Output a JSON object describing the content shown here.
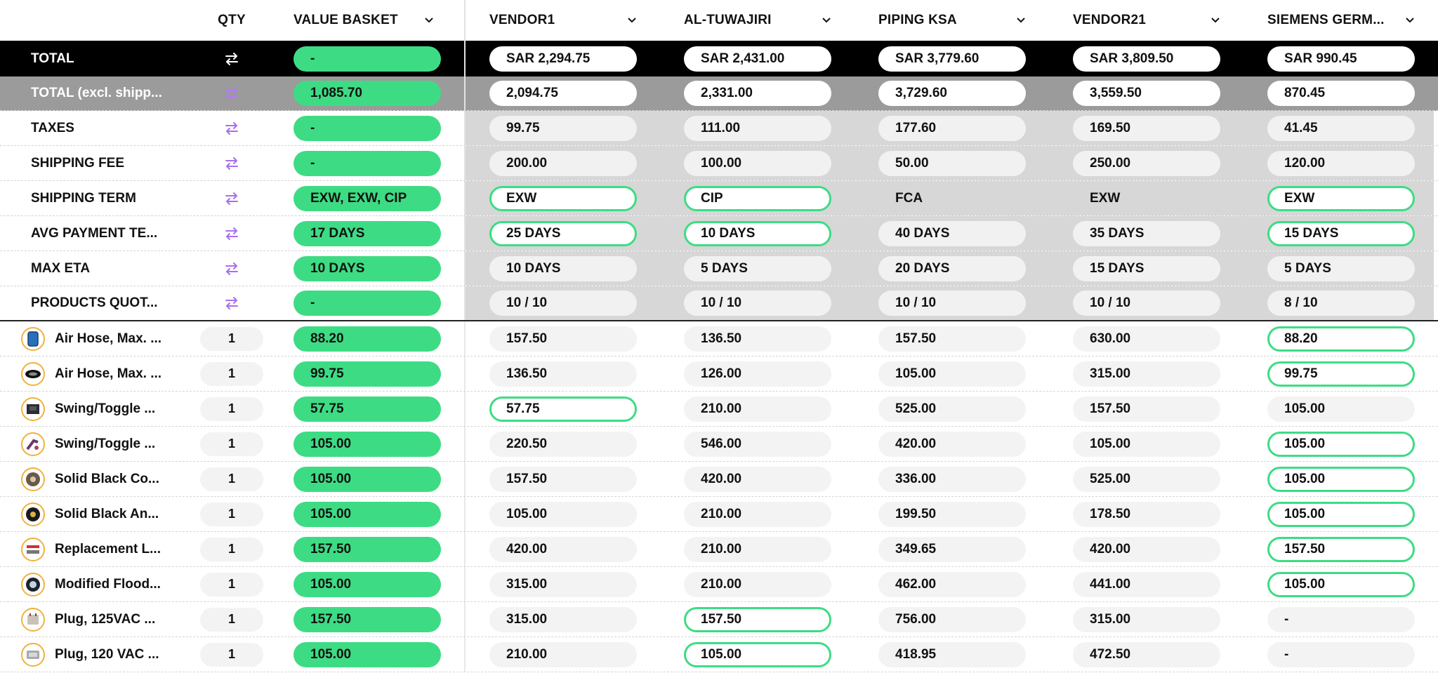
{
  "header": {
    "qty": "QTY",
    "value_basket": "VALUE BASKET",
    "vendors": [
      "VENDOR1",
      "AL-TUWAJIRI",
      "PIPING KSA",
      "VENDOR21",
      "SIEMENS GERM..."
    ]
  },
  "colors": {
    "accent_green": "#3ddc84",
    "swap_purple": "#a86ef0",
    "total_bg": "#000000",
    "total_ex_bg": "#9b9b9b"
  },
  "total": {
    "label": "TOTAL",
    "vb": "-",
    "vendors": [
      "SAR 2,294.75",
      "SAR 2,431.00",
      "SAR 3,779.60",
      "SAR 3,809.50",
      "SAR 990.45"
    ]
  },
  "total_ex": {
    "label": "TOTAL (excl. shipp...",
    "vb": "1,085.70",
    "vendors": [
      "2,094.75",
      "2,331.00",
      "3,729.60",
      "3,559.50",
      "870.45"
    ]
  },
  "summary": [
    {
      "label": "TAXES",
      "vb": "-",
      "vendors": [
        "99.75",
        "111.00",
        "177.60",
        "169.50",
        "41.45"
      ],
      "best": []
    },
    {
      "label": "SHIPPING FEE",
      "vb": "-",
      "vendors": [
        "200.00",
        "100.00",
        "50.00",
        "250.00",
        "120.00"
      ],
      "best": []
    },
    {
      "label": "SHIPPING TERM",
      "vb": "EXW, EXW, CIP",
      "vendors": [
        "EXW",
        "CIP",
        "FCA",
        "EXW",
        "EXW"
      ],
      "best": [
        0,
        1,
        4
      ],
      "flat": [
        2,
        3
      ]
    },
    {
      "label": "AVG PAYMENT TE...",
      "vb": "17 DAYS",
      "vendors": [
        "25 DAYS",
        "10 DAYS",
        "40 DAYS",
        "35 DAYS",
        "15 DAYS"
      ],
      "best": [
        0,
        1,
        4
      ]
    },
    {
      "label": "MAX ETA",
      "vb": "10 DAYS",
      "vendors": [
        "10 DAYS",
        "5 DAYS",
        "20 DAYS",
        "15 DAYS",
        "5 DAYS"
      ],
      "best": []
    },
    {
      "label": "PRODUCTS QUOT...",
      "vb": "-",
      "vendors": [
        "10 / 10",
        "10 / 10",
        "10 / 10",
        "10 / 10",
        "8 / 10"
      ],
      "best": []
    }
  ],
  "products": [
    {
      "name": "Air Hose, Max. ...",
      "icon": "blue-hose-icon",
      "qty": "1",
      "vb": "88.20",
      "vendors": [
        "157.50",
        "136.50",
        "157.50",
        "630.00",
        "88.20"
      ],
      "best": [
        4
      ]
    },
    {
      "name": "Air Hose, Max. ...",
      "icon": "black-hose-icon",
      "qty": "1",
      "vb": "99.75",
      "vendors": [
        "136.50",
        "126.00",
        "105.00",
        "315.00",
        "99.75"
      ],
      "best": [
        4
      ]
    },
    {
      "name": "Swing/Toggle ...",
      "icon": "toggle-box-icon",
      "qty": "1",
      "vb": "57.75",
      "vendors": [
        "57.75",
        "210.00",
        "525.00",
        "157.50",
        "105.00"
      ],
      "best": [
        0
      ]
    },
    {
      "name": "Swing/Toggle ...",
      "icon": "toggle-arm-icon",
      "qty": "1",
      "vb": "105.00",
      "vendors": [
        "220.50",
        "546.00",
        "420.00",
        "105.00",
        "105.00"
      ],
      "best": [
        4
      ]
    },
    {
      "name": "Solid Black Co...",
      "icon": "tape-roll-icon",
      "qty": "1",
      "vb": "105.00",
      "vendors": [
        "157.50",
        "420.00",
        "336.00",
        "525.00",
        "105.00"
      ],
      "best": [
        4
      ]
    },
    {
      "name": "Solid Black An...",
      "icon": "black-tape-icon",
      "qty": "1",
      "vb": "105.00",
      "vendors": [
        "105.00",
        "210.00",
        "199.50",
        "178.50",
        "105.00"
      ],
      "best": [
        4
      ]
    },
    {
      "name": "Replacement L...",
      "icon": "replacement-part-icon",
      "qty": "1",
      "vb": "157.50",
      "vendors": [
        "420.00",
        "210.00",
        "349.65",
        "420.00",
        "157.50"
      ],
      "best": [
        4
      ]
    },
    {
      "name": "Modified Flood...",
      "icon": "flood-light-icon",
      "qty": "1",
      "vb": "105.00",
      "vendors": [
        "315.00",
        "210.00",
        "462.00",
        "441.00",
        "105.00"
      ],
      "best": [
        4
      ]
    },
    {
      "name": "Plug, 125VAC ...",
      "icon": "plug-125-icon",
      "qty": "1",
      "vb": "157.50",
      "vendors": [
        "315.00",
        "157.50",
        "756.00",
        "315.00",
        "-"
      ],
      "best": [
        1
      ]
    },
    {
      "name": "Plug, 120 VAC ...",
      "icon": "plug-120-icon",
      "qty": "1",
      "vb": "105.00",
      "vendors": [
        "210.00",
        "105.00",
        "418.95",
        "472.50",
        "-"
      ],
      "best": [
        1
      ]
    }
  ]
}
